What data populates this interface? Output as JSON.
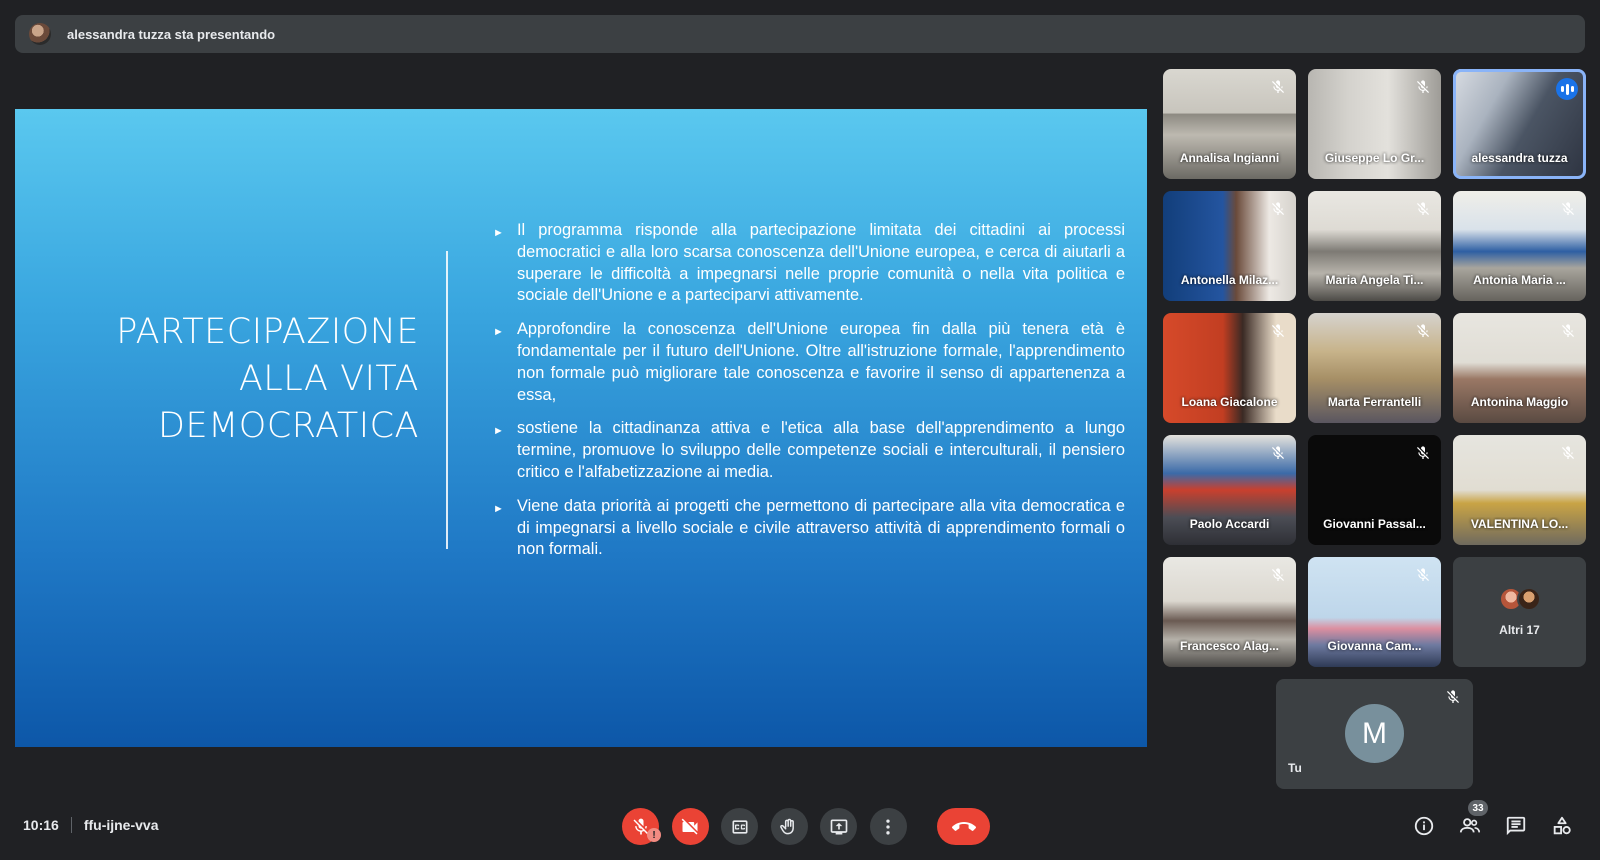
{
  "banner": {
    "presenting_text": "alessandra tuzza sta presentando"
  },
  "slide": {
    "title_lines": [
      "PARTECIPAZIONE",
      "ALLA VITA",
      "DEMOCRATICA"
    ],
    "bullets": [
      "Il programma risponde alla partecipazione limitata dei cittadini ai processi democratici e alla loro scarsa conoscenza dell'Unione europea, e cerca di aiutarli a superare le difficoltà a impegnarsi nelle proprie comunità o nella vita politica e sociale dell'Unione e a parteciparvi attivamente.",
      "Approfondire la conoscenza dell'Unione europea fin dalla più tenera età è fondamentale per il futuro dell'Unione. Oltre all'istruzione formale, l'apprendimento non formale può migliorare tale conoscenza e favorire il senso di appartenenza a essa,",
      "sostiene la cittadinanza attiva e l'etica alla base dell'apprendimento a lungo termine, promuove lo sviluppo delle competenze sociali e interculturali, il pensiero critico e l'alfabetizzazione ai media.",
      "Viene data priorità ai progetti che permettono di partecipare alla vita democratica e di impegnarsi a livello sociale e civile attraverso attività di apprendimento formali o non formali."
    ]
  },
  "participants": [
    {
      "name": "Annalisa Ingianni"
    },
    {
      "name": "Giuseppe Lo Gr..."
    },
    {
      "name": "alessandra tuzza"
    },
    {
      "name": "Antonella Milaz..."
    },
    {
      "name": "Maria Angela Ti..."
    },
    {
      "name": "Antonia Maria ..."
    },
    {
      "name": "Loana Giacalone"
    },
    {
      "name": "Marta Ferrantelli"
    },
    {
      "name": "Antonina Maggio"
    },
    {
      "name": "Paolo Accardi"
    },
    {
      "name": "Giovanni Passal..."
    },
    {
      "name": "VALENTINA LO..."
    },
    {
      "name": "Francesco Alag..."
    },
    {
      "name": "Giovanna Cam..."
    }
  ],
  "others": {
    "label": "Altri 17"
  },
  "self": {
    "initial": "M",
    "label": "Tu"
  },
  "meeting": {
    "time": "10:16",
    "code": "ffu-ijne-vva"
  },
  "people_count": "33",
  "colors": {
    "end_call": "#ea4335",
    "active_speaker": "#8ab4f8",
    "background": "#202124"
  }
}
